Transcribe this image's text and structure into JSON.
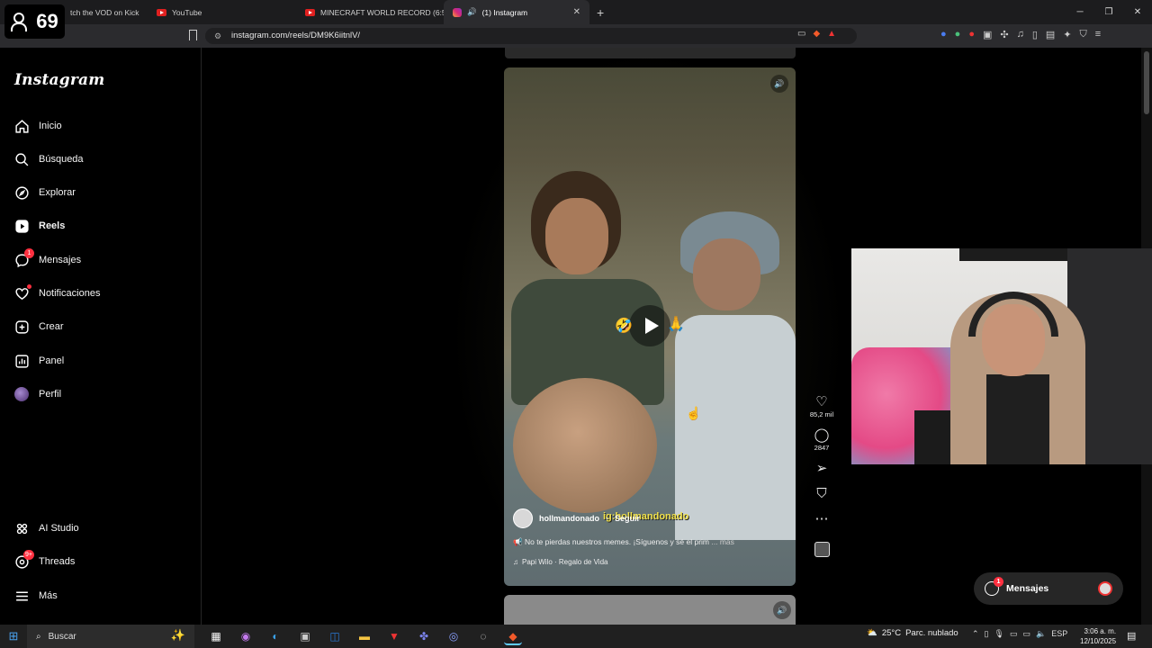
{
  "viewer_count": "69",
  "browser": {
    "tabs": [
      {
        "label": "tch the VOD on Kick"
      },
      {
        "label": "YouTube"
      },
      {
        "label": "MINECRAFT WORLD RECORD (6:50)"
      },
      {
        "label": "(1) Instagram"
      }
    ],
    "url": "instagram.com/reels/DM9K6iitnlV/",
    "close_tab_glyph": "✕",
    "new_tab_glyph": "+"
  },
  "instagram": {
    "logo": "Instagram",
    "nav": [
      {
        "label": "Inicio",
        "icon": "home-icon"
      },
      {
        "label": "Búsqueda",
        "icon": "search-icon"
      },
      {
        "label": "Explorar",
        "icon": "compass-icon"
      },
      {
        "label": "Reels",
        "icon": "reels-icon"
      },
      {
        "label": "Mensajes",
        "icon": "messenger-icon",
        "badge": "1"
      },
      {
        "label": "Notificaciones",
        "icon": "heart-icon"
      },
      {
        "label": "Crear",
        "icon": "plus-square-icon"
      },
      {
        "label": "Panel",
        "icon": "dashboard-icon"
      },
      {
        "label": "Perfil",
        "icon": "avatar"
      }
    ],
    "bottom_nav": [
      {
        "label": "AI Studio",
        "icon": "ai-studio-icon"
      },
      {
        "label": "Threads",
        "icon": "threads-icon",
        "badge": "9+"
      },
      {
        "label": "Más",
        "icon": "menu-icon"
      }
    ],
    "reel": {
      "username": "hollmandonado",
      "separator": "·",
      "follow": "Seguir",
      "watermark": "ig:hollmandonado",
      "caption": "No te pierdas nuestros memes. ¡Síguenos y sé el prim",
      "caption_more": "... más",
      "music": "Papi Wilo · Regalo de Vida",
      "likes": "85,2 mil",
      "comments": "2847"
    },
    "messages_pill": {
      "label": "Mensajes",
      "badge": "1"
    }
  },
  "taskbar": {
    "search_placeholder": "Buscar",
    "weather_temp": "25°C",
    "weather_desc": "Parc. nublado",
    "lang": "ESP",
    "time": "3:06 a. m.",
    "date": "12/10/2025"
  },
  "colors": {
    "accent_red": "#ff3040",
    "sidebar_bg": "#000000",
    "taskbar_bg": "#202020"
  }
}
